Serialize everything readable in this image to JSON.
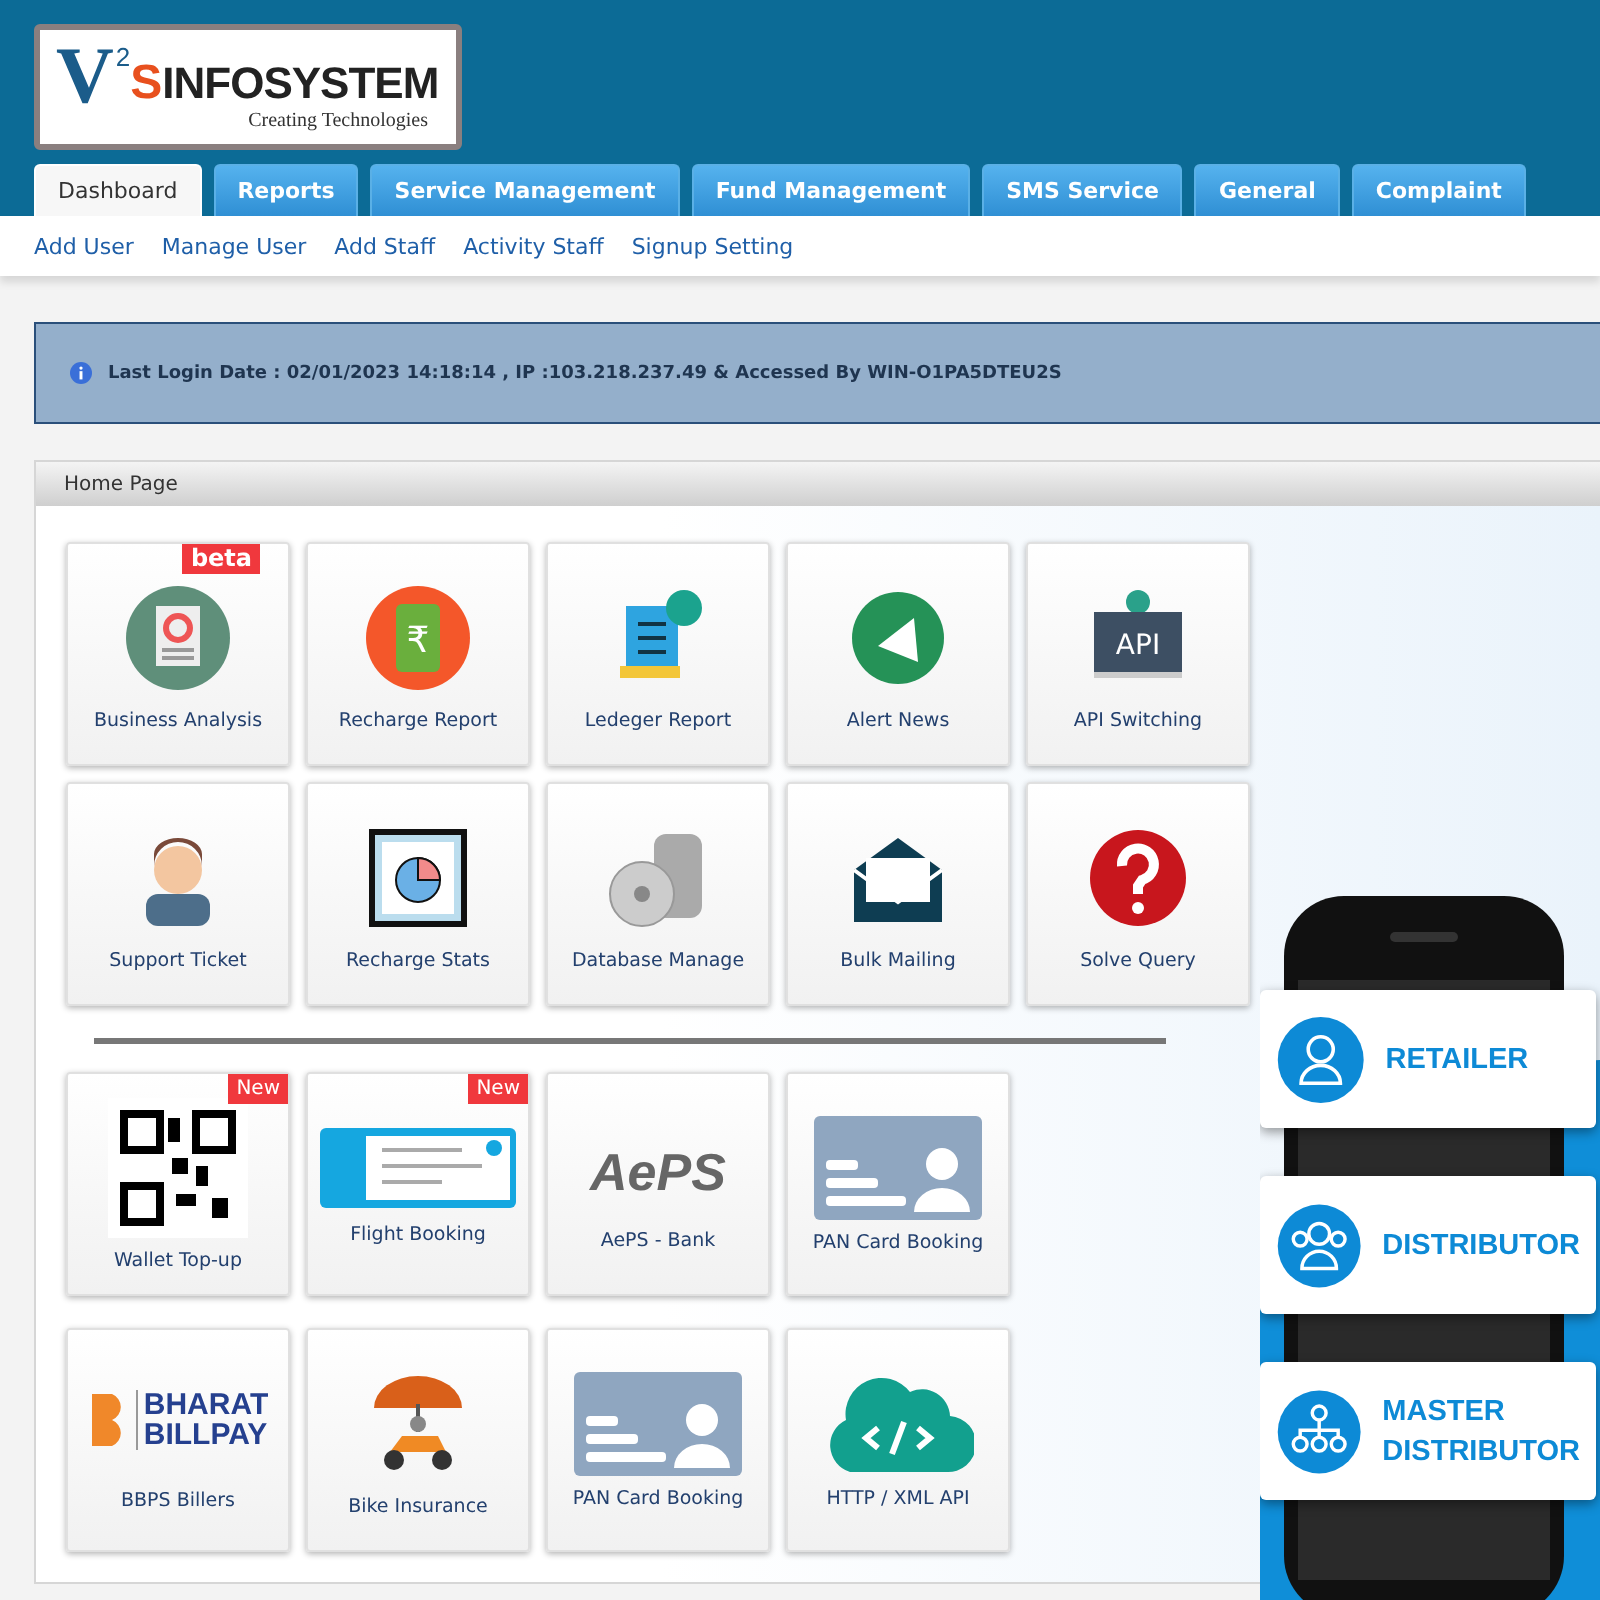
{
  "logo": {
    "mark": "V",
    "mark_small": "2",
    "mark_accent": "S",
    "name": "INFOSYSTEM",
    "tagline": "Creating Technologies"
  },
  "tabs": [
    {
      "label": "Dashboard",
      "selected": true
    },
    {
      "label": "Reports",
      "selected": false
    },
    {
      "label": "Service Management",
      "selected": false
    },
    {
      "label": "Fund Management",
      "selected": false
    },
    {
      "label": "SMS Service",
      "selected": false
    },
    {
      "label": "General",
      "selected": false
    },
    {
      "label": "Complaint",
      "selected": false
    }
  ],
  "sub_nav": [
    "Add User",
    "Manage User",
    "Add Staff",
    "Activity Staff",
    "Signup Setting"
  ],
  "login_info": "Last Login Date : 02/01/2023 14:18:14 , IP :103.218.237.49 & Accessed By WIN-O1PA5DTEU2S",
  "panel": {
    "title": "Home Page",
    "tiles": [
      {
        "label": "Business Analysis",
        "kind": "analysis",
        "badge": "beta"
      },
      {
        "label": "Recharge Report",
        "kind": "recharge",
        "icon_text": "₹"
      },
      {
        "label": "Ledeger Report",
        "kind": "ledger"
      },
      {
        "label": "Alert News",
        "kind": "alert"
      },
      {
        "label": "API Switching",
        "kind": "api",
        "icon_text": "API"
      },
      {
        "label": "Support Ticket",
        "kind": "support"
      },
      {
        "label": "Recharge Stats",
        "kind": "stats"
      },
      {
        "label": "Database Manage",
        "kind": "database"
      },
      {
        "label": "Bulk Mailing",
        "kind": "mail"
      },
      {
        "label": "Solve Query",
        "kind": "query"
      }
    ],
    "service_tiles": [
      {
        "label": "Wallet Top-up",
        "kind": "qr",
        "badge": "New"
      },
      {
        "label": "Flight Booking",
        "kind": "flight",
        "badge": "New"
      },
      {
        "label": "AePS - Bank",
        "kind": "aeps",
        "logo_text": [
          "AePS"
        ]
      },
      {
        "label": "PAN Card Booking",
        "kind": "pan"
      },
      {
        "label": "BBPS Billers",
        "kind": "bbps",
        "logo_text": [
          "BHARAT",
          "BILLPAY"
        ]
      },
      {
        "label": "Bike Insurance",
        "kind": "bike"
      },
      {
        "label": "PAN Card Booking",
        "kind": "pan"
      },
      {
        "label": "HTTP / XML API",
        "kind": "cloud"
      }
    ]
  },
  "roles": [
    {
      "label": "RETAILER",
      "kind": "single"
    },
    {
      "label": "DISTRIBUTOR",
      "kind": "group"
    },
    {
      "label": "MASTER DISTRIBUTOR",
      "kind": "tree"
    }
  ]
}
